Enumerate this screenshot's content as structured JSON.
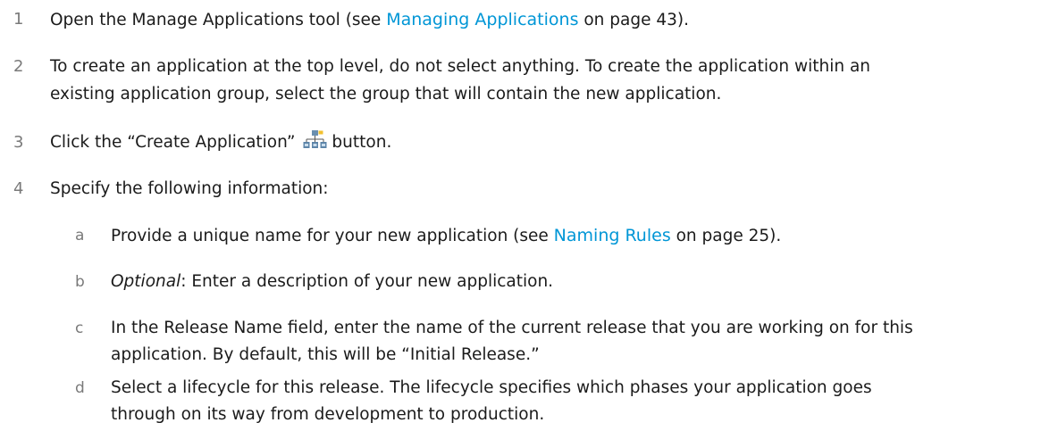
{
  "steps": [
    {
      "number": "1",
      "text_before": "Open the Manage Applications tool (see ",
      "link": "Managing Applications",
      "text_after": " on page 43)."
    },
    {
      "number": "2",
      "line1": "To create an application at the top level, do not select anything. To create the application within an",
      "line2": "existing application group, select the group that will contain the new application."
    },
    {
      "number": "3",
      "text_before": "Click the “Create Application”",
      "icon": "create-application-icon",
      "text_after": "button."
    },
    {
      "number": "4",
      "text": "Specify the following information:"
    }
  ],
  "substeps": [
    {
      "letter": "a",
      "text_before": "Provide a unique name for your new application (see ",
      "link": "Naming Rules",
      "text_after": " on page 25)."
    },
    {
      "letter": "b",
      "italic": "Optional",
      "text": ": Enter a description of your new application."
    },
    {
      "letter": "c",
      "line1": "In the Release Name field, enter the name of the current release that you are working on for this",
      "line2": "application. By default, this will be “Initial Release.”"
    },
    {
      "letter": "d",
      "line1": "Select a lifecycle for this release. The lifecycle specifies which phases your application goes",
      "line2": "through on its way from development to production."
    }
  ],
  "colors": {
    "link": "#0096d6",
    "step_number": "#7a7a7a",
    "body_text": "#1b1b1b"
  }
}
